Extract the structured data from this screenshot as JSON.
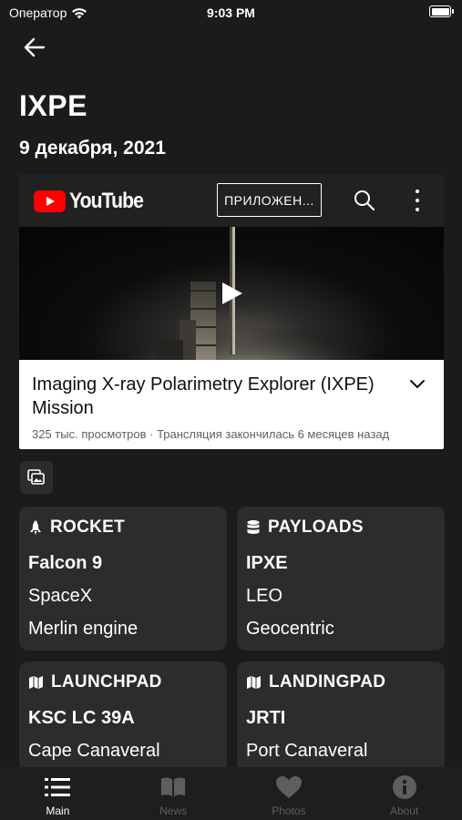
{
  "status_bar": {
    "carrier": "Оператор",
    "time": "9:03 PM"
  },
  "page": {
    "title": "IXPE",
    "date": "9 декабря, 2021"
  },
  "video": {
    "brand": "YouTube",
    "app_button": "ПРИЛОЖЕН...",
    "title": "Imaging X-ray Polarimetry Explorer (IXPE) Mission",
    "meta": "325 тыс. просмотров · Трансляция закончилась 6 месяцев назад"
  },
  "cards": {
    "rocket": {
      "heading": "ROCKET",
      "primary": "Falcon 9",
      "line1": "SpaceX",
      "line2": "Merlin engine"
    },
    "payloads": {
      "heading": "PAYLOADS",
      "primary": "IPXE",
      "line1": "LEO",
      "line2": "Geocentric"
    },
    "launchpad": {
      "heading": "LAUNCHPAD",
      "primary": "KSC LC 39A",
      "line1": "Cape Canaveral"
    },
    "landingpad": {
      "heading": "LANDINGPAD",
      "primary": "JRTI",
      "line1": "Port Canaveral"
    }
  },
  "tabs": [
    {
      "label": "Main",
      "icon": "list-icon",
      "active": true
    },
    {
      "label": "News",
      "icon": "book-icon",
      "active": false
    },
    {
      "label": "Photos",
      "icon": "heart-icon",
      "active": false
    },
    {
      "label": "About",
      "icon": "info-icon",
      "active": false
    }
  ],
  "colors": {
    "background": "#1b1b1b",
    "card": "#2c2c2e",
    "tab_active": "#ffffff",
    "tab_inactive": "#5e5e5e",
    "youtube_red": "#ff0000"
  }
}
